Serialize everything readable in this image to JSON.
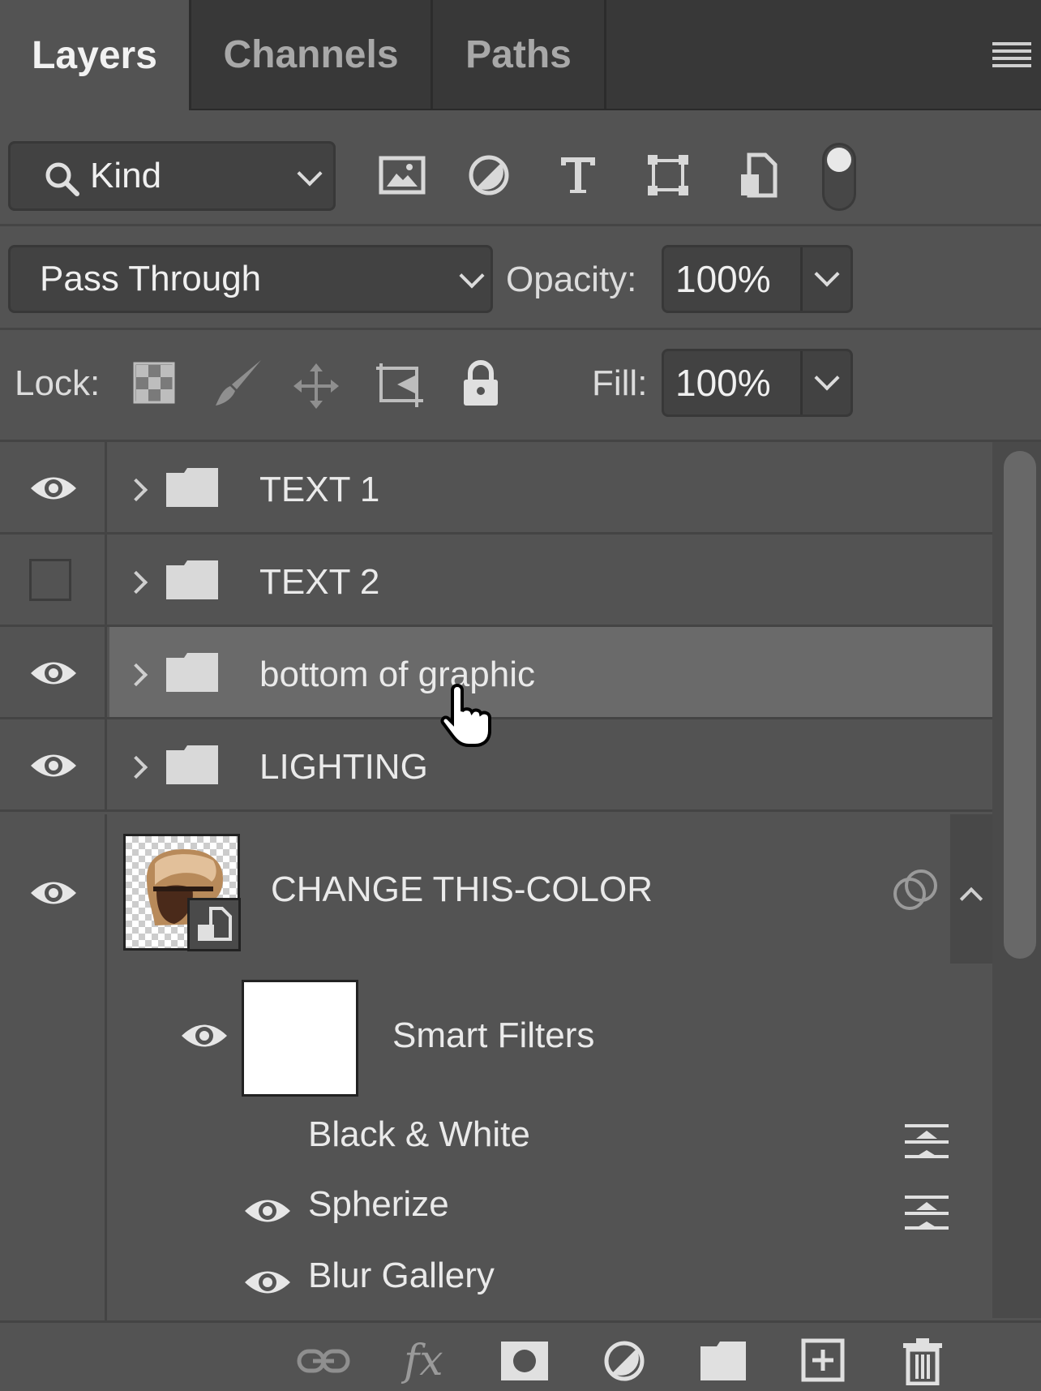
{
  "tabs": [
    {
      "label": "Layers",
      "active": true
    },
    {
      "label": "Channels",
      "active": false
    },
    {
      "label": "Paths",
      "active": false
    }
  ],
  "filter": {
    "kind_label": "Kind",
    "icons": [
      "image-filter-icon",
      "adjustment-filter-icon",
      "type-filter-icon",
      "shape-filter-icon",
      "smart-object-filter-icon",
      "filter-toggle-icon"
    ]
  },
  "blend": {
    "mode": "Pass Through",
    "opacity_label": "Opacity:",
    "opacity_value": "100%"
  },
  "lock": {
    "label": "Lock:",
    "icons": [
      "lock-transparent-pixels-icon",
      "lock-image-pixels-icon",
      "lock-position-icon",
      "lock-artboard-icon",
      "lock-all-icon"
    ],
    "fill_label": "Fill:",
    "fill_value": "100%"
  },
  "layers": [
    {
      "name": "TEXT 1",
      "visible": true,
      "type": "group"
    },
    {
      "name": "TEXT 2",
      "visible": false,
      "type": "group"
    },
    {
      "name": "bottom of graphic",
      "visible": true,
      "type": "group",
      "selected": true
    },
    {
      "name": "LIGHTING",
      "visible": true,
      "type": "group"
    },
    {
      "name": "CHANGE THIS-COLOR",
      "visible": true,
      "type": "smart-object"
    }
  ],
  "smart_filters": {
    "label": "Smart Filters",
    "filters": [
      {
        "name": "Black & White",
        "visible": null
      },
      {
        "name": "Spherize",
        "visible": true
      },
      {
        "name": "Blur Gallery",
        "visible": true
      }
    ]
  },
  "bottom_icons": [
    "link-layers-icon",
    "fx-icon",
    "add-mask-icon",
    "adjustment-layer-icon",
    "new-group-icon",
    "new-layer-icon",
    "trash-icon"
  ],
  "colors": {
    "panel": "#535353",
    "tabbar": "#383838",
    "selected": "#6a6a6a"
  }
}
